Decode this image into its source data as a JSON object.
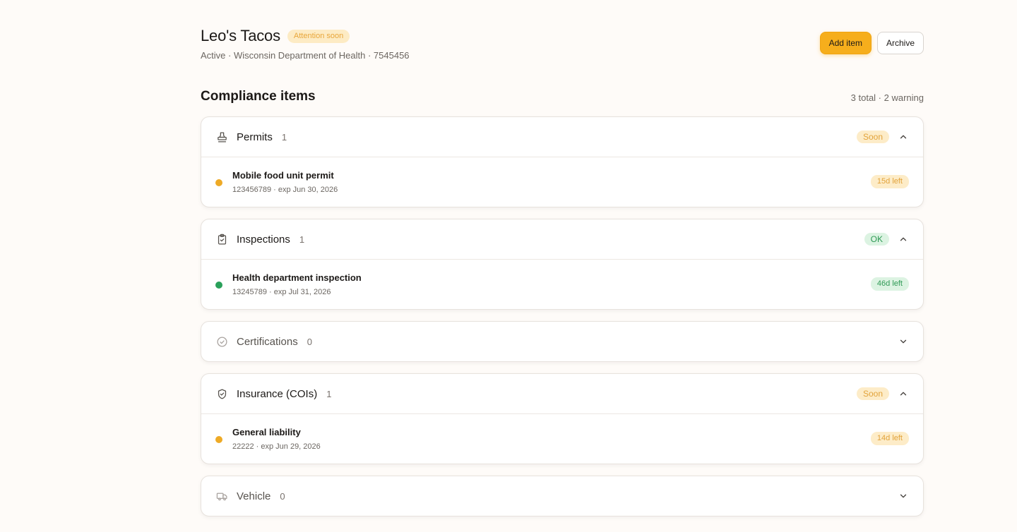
{
  "header": {
    "title": "Leo's Tacos",
    "badge": "Attention soon",
    "subtitle": "Active · Wisconsin Department of Health · 7545456",
    "add_label": "Add item",
    "archive_label": "Archive"
  },
  "section": {
    "title": "Compliance items",
    "summary": "3 total · 2 warning"
  },
  "categories": [
    {
      "name": "Permits",
      "count": "1",
      "status": "Soon",
      "icon": "stamp-icon",
      "expanded": true,
      "items": [
        {
          "name": "Mobile food unit permit",
          "meta": "123456789 · exp Jun 30, 2026",
          "days": "15d left",
          "status_color": "#eeaa26"
        }
      ]
    },
    {
      "name": "Inspections",
      "count": "1",
      "status": "OK",
      "icon": "clipboard-check-icon",
      "expanded": true,
      "items": [
        {
          "name": "Health department inspection",
          "meta": "13245789 · exp Jul 31, 2026",
          "days": "46d left",
          "status_color": "#2aa05a"
        }
      ]
    },
    {
      "name": "Certifications",
      "count": "0",
      "status": "",
      "icon": "circle-check-icon",
      "expanded": false,
      "items": []
    },
    {
      "name": "Insurance (COIs)",
      "count": "1",
      "status": "Soon",
      "icon": "shield-check-icon",
      "expanded": true,
      "items": [
        {
          "name": "General liability",
          "meta": "22222 · exp Jun 29, 2026",
          "days": "14d left",
          "status_color": "#eeaa26"
        }
      ]
    },
    {
      "name": "Vehicle",
      "count": "0",
      "status": "",
      "icon": "truck-icon",
      "expanded": false,
      "items": []
    }
  ],
  "colors": {
    "accent": "#f6ae1c",
    "warning": "#eeaa26",
    "ok": "#2aa05a"
  }
}
